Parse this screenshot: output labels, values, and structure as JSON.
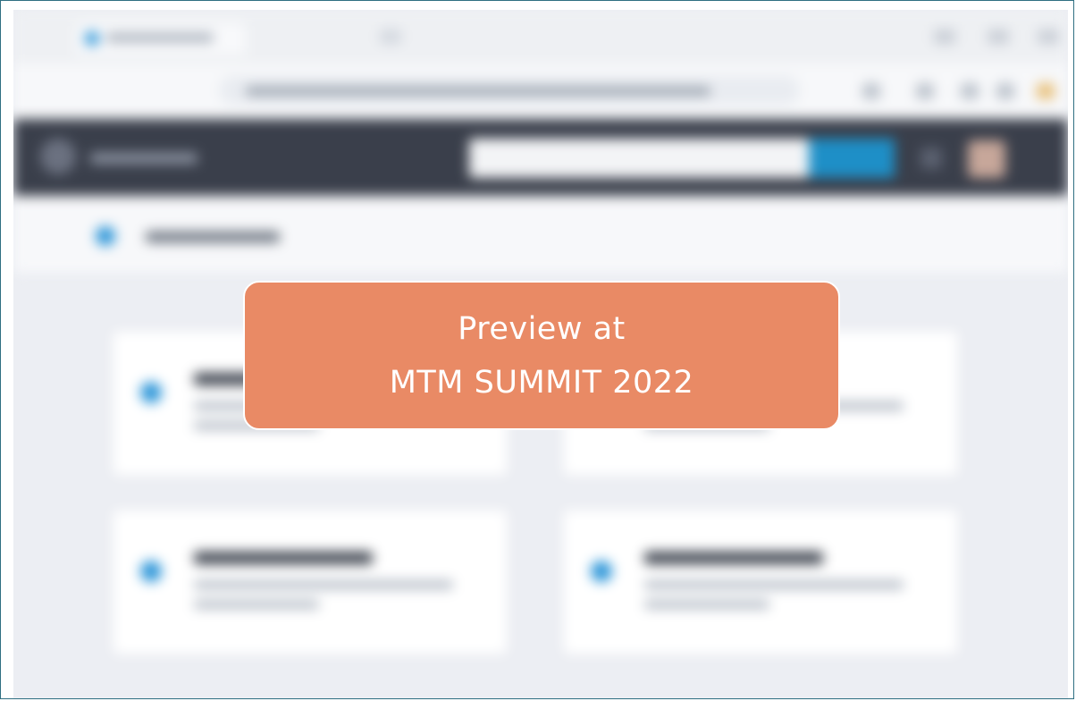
{
  "banner": {
    "line1": "Preview at",
    "line2": "MTM SUMMIT 2022"
  },
  "colors": {
    "frame_border": "#2f6f82",
    "banner_bg": "#e98a65",
    "header_bg": "#3a3f4b",
    "accent": "#1e8fc7",
    "page_bg": "#eceef3"
  },
  "icons": [
    "favicon-icon",
    "back-icon",
    "forward-icon",
    "reload-icon",
    "home-icon",
    "logo-icon",
    "notification-icon",
    "avatar",
    "dashboard-icon",
    "card-icon"
  ]
}
